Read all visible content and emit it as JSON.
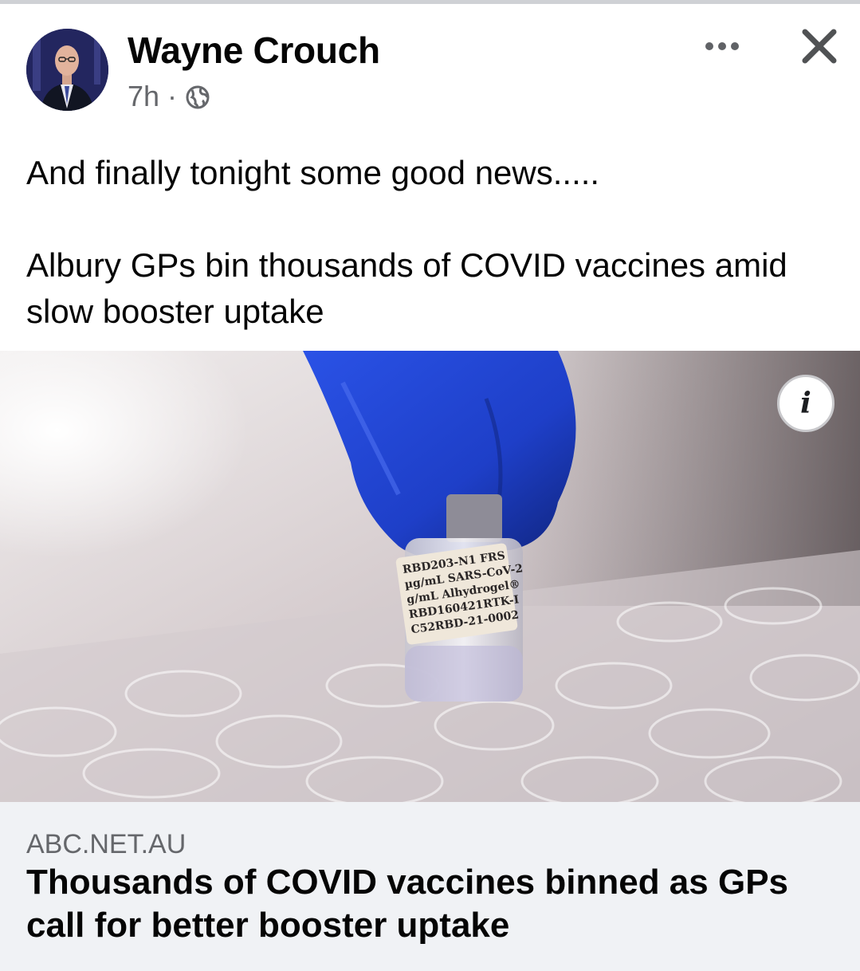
{
  "post": {
    "author": "Wayne Crouch",
    "time": "7h",
    "separator": "·",
    "visibility_icon": "globe-icon",
    "text_line1": "And finally tonight some good news.....",
    "text_line2": "Albury GPs bin thousands of COVID vaccines amid slow booster uptake"
  },
  "header_actions": {
    "more_icon": "more-options-icon",
    "close_icon": "close-icon"
  },
  "image": {
    "info_label": "i",
    "vial_label_lines": [
      "RBD203-N1 FRS",
      "µg/mL SARS-CoV-2",
      "g/mL Alhydrogel®",
      "RBD160421RTK-I",
      "C52RBD-21-0002"
    ]
  },
  "link_preview": {
    "domain": "ABC.NET.AU",
    "title": "Thousands of COVID vaccines binned as GPs call for better booster uptake"
  },
  "colors": {
    "link_box_bg": "#f0f2f5",
    "secondary_text": "#65676b",
    "glove_blue": "#1e3fc8"
  }
}
